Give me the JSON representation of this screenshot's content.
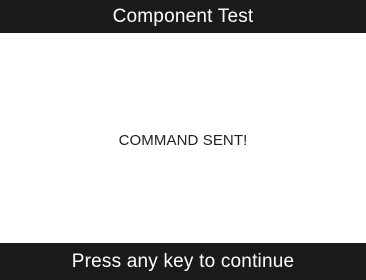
{
  "header": {
    "title": "Component Test"
  },
  "main": {
    "message": "COMMAND SENT!"
  },
  "footer": {
    "prompt": "Press any key to continue"
  },
  "colors": {
    "bar_background": "#1a1a1a",
    "bar_text": "#ffffff",
    "content_background": "#ffffff",
    "content_text": "#222222"
  }
}
